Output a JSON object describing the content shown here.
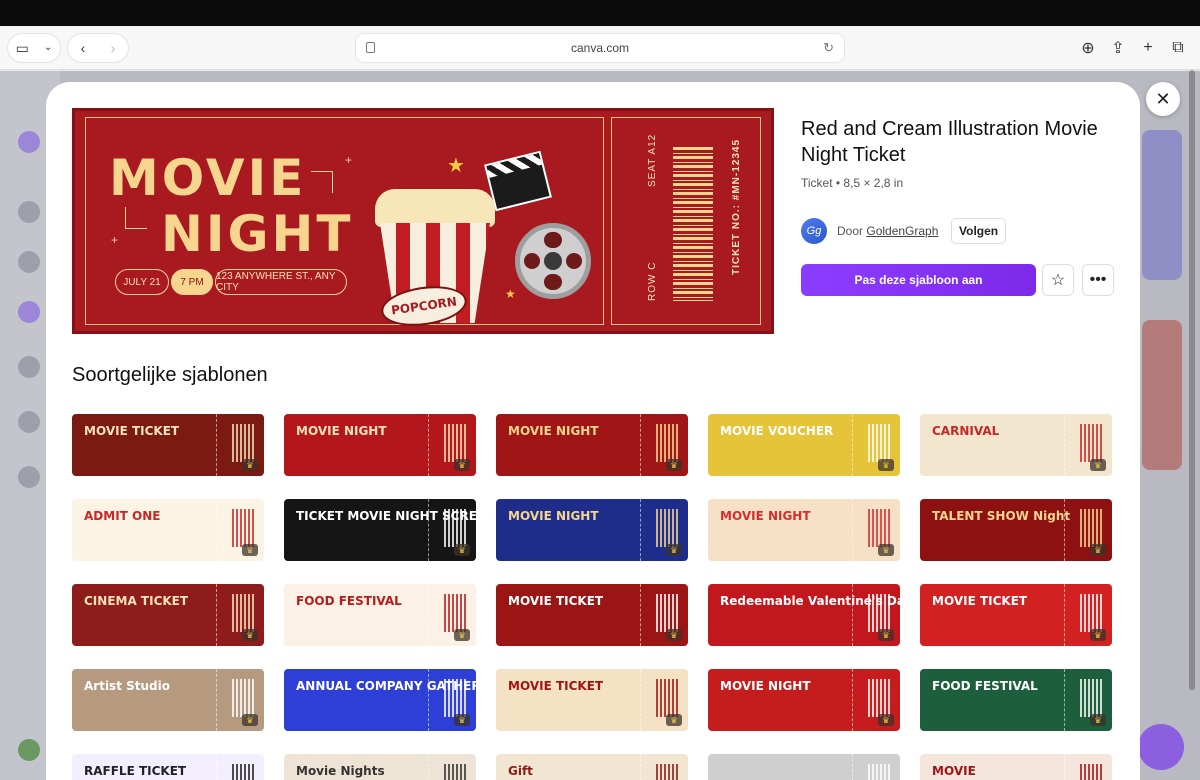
{
  "browser": {
    "address": "canva.com"
  },
  "hero": {
    "title_line1": "MOVIE",
    "title_line2": "NIGHT",
    "date": "JULY 21",
    "time": "7 PM",
    "address": "123 ANYWHERE ST., ANY CITY",
    "popcorn_label": "POPCORN",
    "seat": "SEAT A12",
    "row": "ROW C",
    "ticket_no": "TICKET NO.: #MN-12345"
  },
  "template": {
    "title": "Red and Cream Illustration Movie Night Ticket",
    "meta": "Ticket • 8,5 × 2,8 in",
    "author_prefix": "Door",
    "author_name": "GoldenGraph",
    "author_initials": "Gg",
    "follow_label": "Volgen",
    "primary_label": "Pas deze sjabloon aan"
  },
  "section_title": "Soortgelijke sjablonen",
  "cards": [
    {
      "title": "MOVIE TICKET",
      "bg": "#7a1a12",
      "fg": "#f6e2b8"
    },
    {
      "title": "MOVIE NIGHT",
      "bg": "#b3161b",
      "fg": "#f6e2b8"
    },
    {
      "title": "MOVIE NIGHT",
      "bg": "#a01515",
      "fg": "#f6d58f"
    },
    {
      "title": "MOVIE VOUCHER",
      "bg": "#e6c43a",
      "fg": "#ffffff"
    },
    {
      "title": "CARNIVAL",
      "bg": "#f3e6cf",
      "fg": "#c62828"
    },
    {
      "title": "ADMIT ONE",
      "bg": "#fbf3e3",
      "fg": "#c62828"
    },
    {
      "title": "TICKET MOVIE NIGHT SCREENINGS",
      "bg": "#151515",
      "fg": "#ffffff"
    },
    {
      "title": "MOVIE NIGHT",
      "bg": "#1f2d8a",
      "fg": "#f6d58f"
    },
    {
      "title": "MOVIE NIGHT",
      "bg": "#f7e1c6",
      "fg": "#d32f2f"
    },
    {
      "title": "TALENT SHOW Night",
      "bg": "#8d1111",
      "fg": "#f6d58f"
    },
    {
      "title": "CINEMA TICKET",
      "bg": "#8e1c1c",
      "fg": "#f6e2b8"
    },
    {
      "title": "FOOD FESTIVAL",
      "bg": "#fbf1e6",
      "fg": "#b71c1c"
    },
    {
      "title": "MOVIE TICKET",
      "bg": "#9b1515",
      "fg": "#ffffff"
    },
    {
      "title": "Redeemable Valentine's Day Ticket",
      "bg": "#c2181d",
      "fg": "#ffffff"
    },
    {
      "title": "MOVIE TICKET",
      "bg": "#d32020",
      "fg": "#ffffff"
    },
    {
      "title": "Artist Studio",
      "bg": "#b69a80",
      "fg": "#ffffff"
    },
    {
      "title": "ANNUAL COMPANY GATHERING",
      "bg": "#2d3fd6",
      "fg": "#ffffff"
    },
    {
      "title": "MOVIE TICKET",
      "bg": "#f3e3c4",
      "fg": "#a31515"
    },
    {
      "title": "MOVIE NIGHT",
      "bg": "#c51d1d",
      "fg": "#ffffff"
    },
    {
      "title": "FOOD FESTIVAL",
      "bg": "#1d5f3d",
      "fg": "#ffffff"
    },
    {
      "title": "RAFFLE TICKET",
      "bg": "#f3efff",
      "fg": "#222222"
    },
    {
      "title": "Movie Nights",
      "bg": "#ede4d5",
      "fg": "#333333"
    },
    {
      "title": "Gift",
      "bg": "#f1e6d2",
      "fg": "#8b1a1a"
    },
    {
      "title": "",
      "bg": "#cfcfcf",
      "fg": "#ffffff"
    },
    {
      "title": "MOVIE",
      "bg": "#f4e6dc",
      "fg": "#a31515"
    }
  ],
  "colors": {
    "accent": "#8b3dff",
    "hero_red": "#a81a1f",
    "hero_cream": "#f6d58f"
  }
}
